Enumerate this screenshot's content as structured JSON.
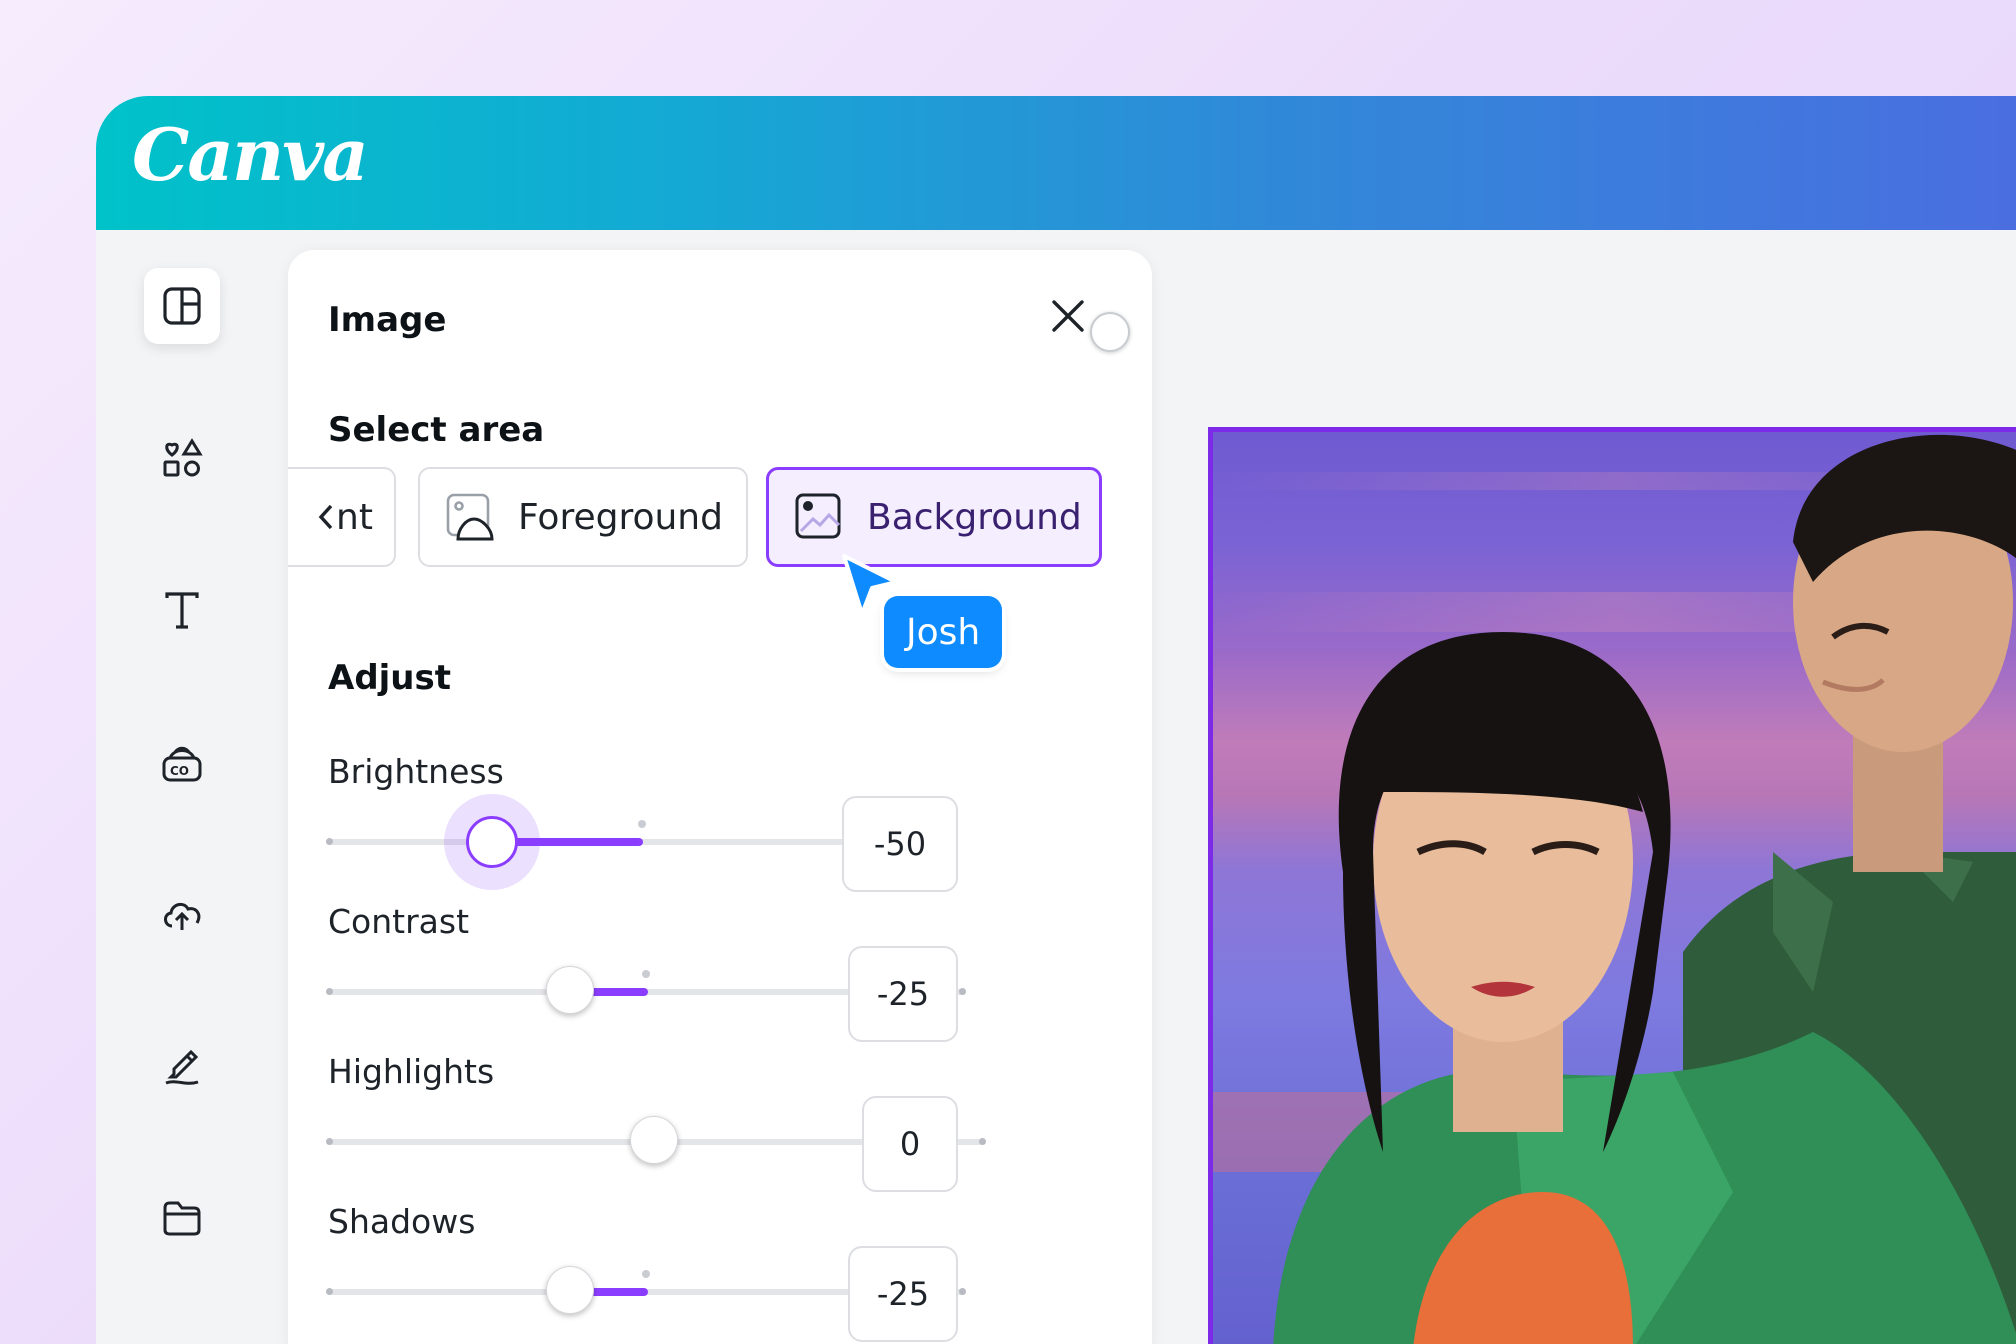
{
  "app": {
    "logo_text": "Canva"
  },
  "sidebar": {
    "items": [
      {
        "name": "design-layout",
        "icon": "layout-panel-icon",
        "active": true
      },
      {
        "name": "elements",
        "icon": "shapes-icon",
        "active": false
      },
      {
        "name": "text",
        "icon": "text-icon",
        "active": false
      },
      {
        "name": "brand",
        "icon": "brand-kit-icon",
        "active": false
      },
      {
        "name": "uploads",
        "icon": "cloud-upload-icon",
        "active": false
      },
      {
        "name": "draw",
        "icon": "draw-pen-icon",
        "active": false
      },
      {
        "name": "projects",
        "icon": "folder-icon",
        "active": false
      }
    ]
  },
  "panel": {
    "title": "Image",
    "select_area": {
      "title": "Select area",
      "options": [
        {
          "label": "nt",
          "icon": "chevron-left-icon"
        },
        {
          "label": "Foreground",
          "icon": "image-foreground-icon"
        },
        {
          "label": "Background",
          "icon": "image-background-icon",
          "selected": true
        }
      ]
    },
    "adjust": {
      "title": "Adjust",
      "sliders": [
        {
          "label": "Brightness",
          "value": "-50",
          "numeric": -50
        },
        {
          "label": "Contrast",
          "value": "-25",
          "numeric": -25
        },
        {
          "label": "Highlights",
          "value": "0",
          "numeric": 0
        },
        {
          "label": "Shadows",
          "value": "-25",
          "numeric": -25
        }
      ]
    }
  },
  "collaborator": {
    "name": "Josh",
    "color": "#0d8bff"
  },
  "colors": {
    "accent": "#8b3dff",
    "selection": "#7d2ae8"
  }
}
